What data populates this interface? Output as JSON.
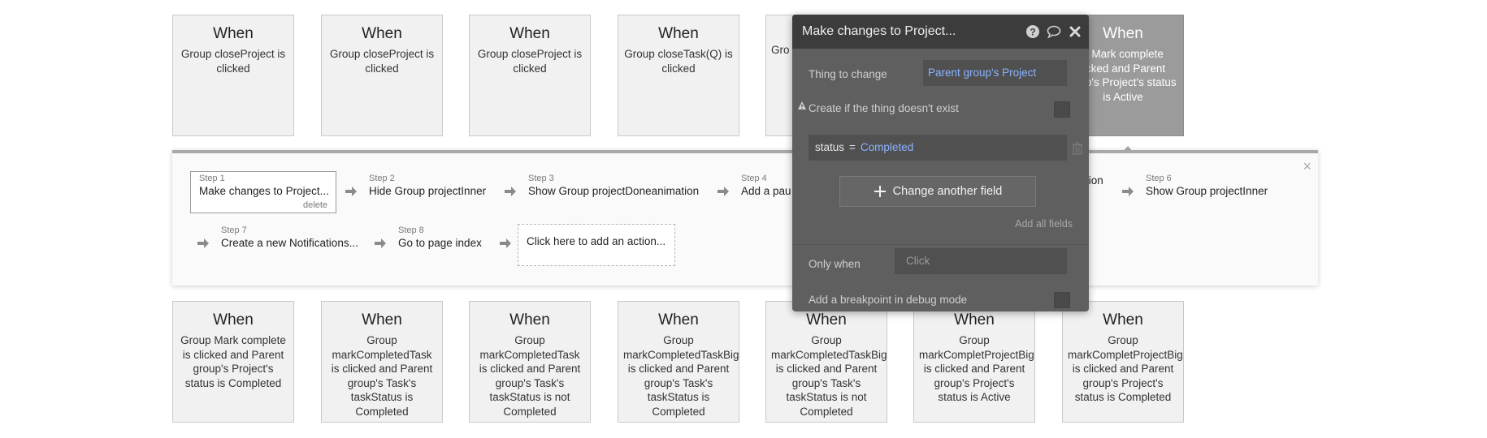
{
  "top_cards": [
    {
      "when": "When",
      "desc": "Group closeProject is clicked"
    },
    {
      "when": "When",
      "desc": "Group closeProject is clicked"
    },
    {
      "when": "When",
      "desc": "Group closeProject is clicked"
    },
    {
      "when": "When",
      "desc": "Group closeTask(Q) is clicked"
    },
    {
      "when": "",
      "desc": "Gro"
    },
    {
      "when": "",
      "desc": ""
    },
    {
      "when": "When",
      "desc": "p Mark complete licked and Parent roup's Project's status is Active"
    }
  ],
  "bottom_cards": [
    {
      "when": "When",
      "desc": "Group Mark complete is clicked and Parent group's Project's status is Completed"
    },
    {
      "when": "When",
      "desc": "Group markCompletedTask is clicked and Parent group's Task's taskStatus is Completed"
    },
    {
      "when": "When",
      "desc": "Group markCompletedTask is clicked and Parent group's Task's taskStatus is not Completed"
    },
    {
      "when": "When",
      "desc": "Group markCompletedTaskBig is clicked and Parent group's Task's taskStatus is Completed"
    },
    {
      "when": "When",
      "desc": "Group markCompletedTaskBig is clicked and Parent group's Task's taskStatus is not Completed"
    },
    {
      "when": "When",
      "desc": "Group markCompletProjectBig is clicked and Parent group's Project's status is Active"
    },
    {
      "when": "When",
      "desc": "Group markCompletProjectBig is clicked and Parent group's Project's status is Completed"
    }
  ],
  "workflow": {
    "close": "×",
    "delete": "delete",
    "steps": [
      {
        "label": "Step 1",
        "title": "Make changes to Project..."
      },
      {
        "label": "Step 2",
        "title": "Hide Group projectInner"
      },
      {
        "label": "Step 3",
        "title": "Show Group projectDoneanimation"
      },
      {
        "label": "Step 4",
        "title": "Add a pau"
      },
      {
        "label": "",
        "title": "tion"
      },
      {
        "label": "Step 6",
        "title": "Show Group projectInner"
      },
      {
        "label": "Step 7",
        "title": "Create a new Notifications..."
      },
      {
        "label": "Step 8",
        "title": "Go to page index"
      }
    ],
    "add_action": "Click here to add an action..."
  },
  "editor": {
    "title": "Make changes to Project...",
    "icons": [
      "help-icon",
      "comment-icon",
      "close-icon"
    ],
    "thing_label": "Thing to change",
    "thing_value": "Parent group's Project",
    "create_label": "Create if the thing doesn't exist",
    "field_name": "status",
    "field_eq": "=",
    "field_value": "Completed",
    "change_button": "Change another field",
    "add_all": "Add all fields",
    "only_when_label": "Only when",
    "only_when_placeholder": "Click",
    "breakpoint_label": "Add a breakpoint in debug mode"
  }
}
